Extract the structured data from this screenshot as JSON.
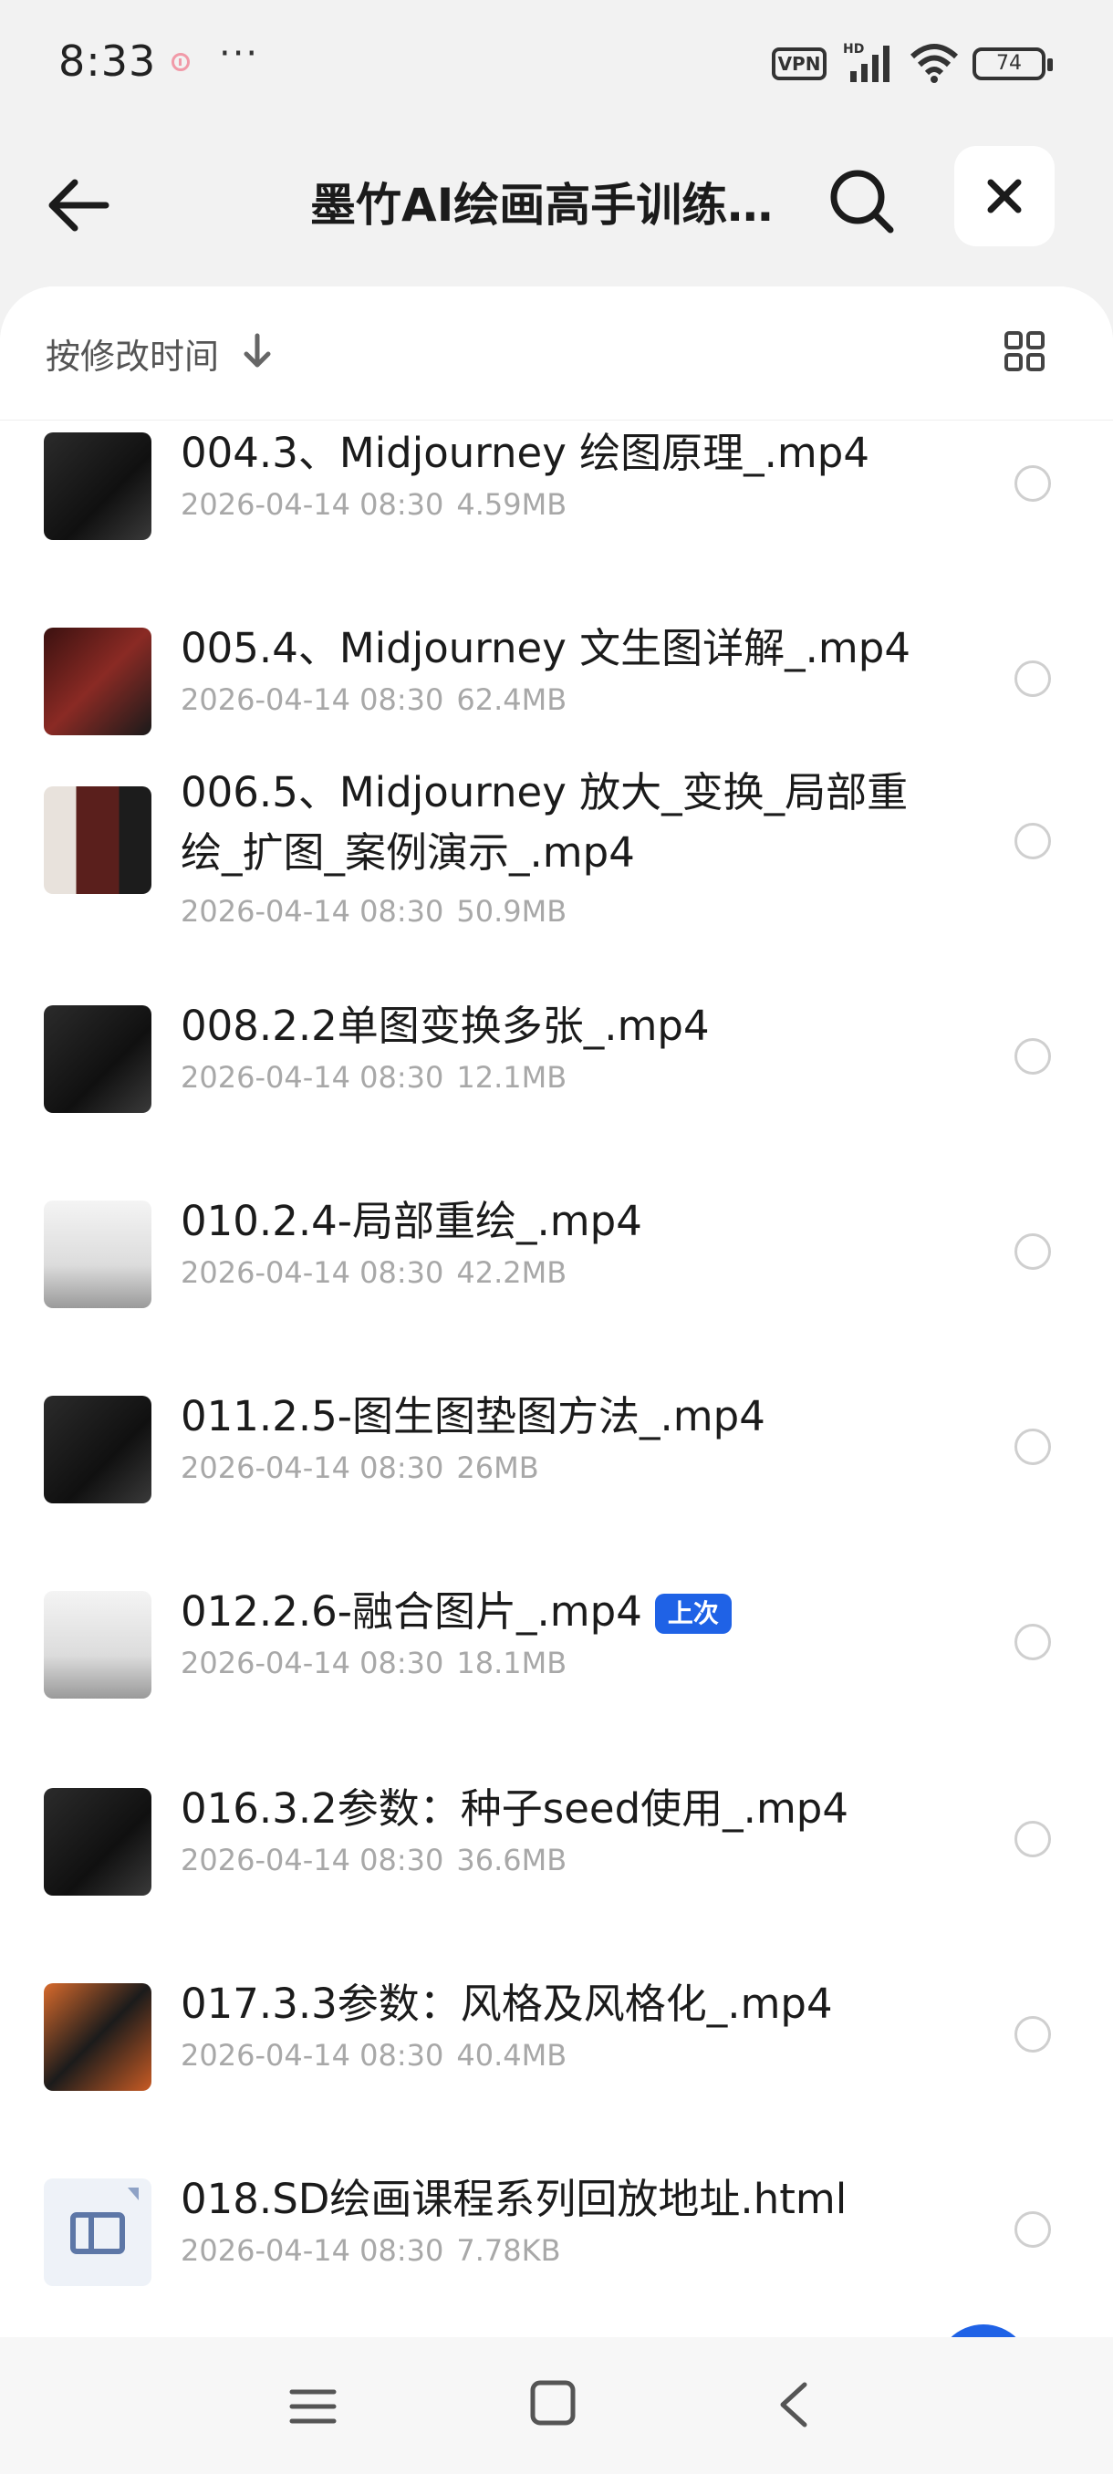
{
  "status_bar": {
    "time": "8:33",
    "more": "···",
    "vpn": "VPN",
    "battery": "74"
  },
  "header": {
    "title": "墨竹AI绘画高手训练…"
  },
  "sort": {
    "label": "按修改时间"
  },
  "files": [
    {
      "name": "004.3、Midjourney 绘图原理_.mp4",
      "date": "2026-04-14 08:30",
      "size": "4.59MB",
      "thumb": "dark"
    },
    {
      "name": "005.4、Midjourney 文生图详解_.mp4",
      "date": "2026-04-14 08:30",
      "size": "62.4MB",
      "thumb": "red"
    },
    {
      "name": "006.5、Midjourney 放大_变换_局部重绘_扩图_案例演示_.mp4",
      "date": "2026-04-14 08:30",
      "size": "50.9MB",
      "thumb": "split"
    },
    {
      "name": "008.2.2单图变换多张_.mp4",
      "date": "2026-04-14 08:30",
      "size": "12.1MB",
      "thumb": "dark"
    },
    {
      "name": "010.2.4-局部重绘_.mp4",
      "date": "2026-04-14 08:30",
      "size": "42.2MB",
      "thumb": "light"
    },
    {
      "name": "011.2.5-图生图垫图方法_.mp4",
      "date": "2026-04-14 08:30",
      "size": "26MB",
      "thumb": "dark"
    },
    {
      "name": "012.2.6-融合图片_.mp4",
      "date": "2026-04-14 08:30",
      "size": "18.1MB",
      "thumb": "light",
      "badge": "上次"
    },
    {
      "name": "016.3.2参数：种子seed使用_.mp4",
      "date": "2026-04-14 08:30",
      "size": "36.6MB",
      "thumb": "dark"
    },
    {
      "name": "017.3.3参数：风格及风格化_.mp4",
      "date": "2026-04-14 08:30",
      "size": "40.4MB",
      "thumb": "orange"
    },
    {
      "name": "018.SD绘画课程系列回放地址.html",
      "date": "2026-04-14 08:30",
      "size": "7.78KB",
      "thumb": "html"
    }
  ]
}
